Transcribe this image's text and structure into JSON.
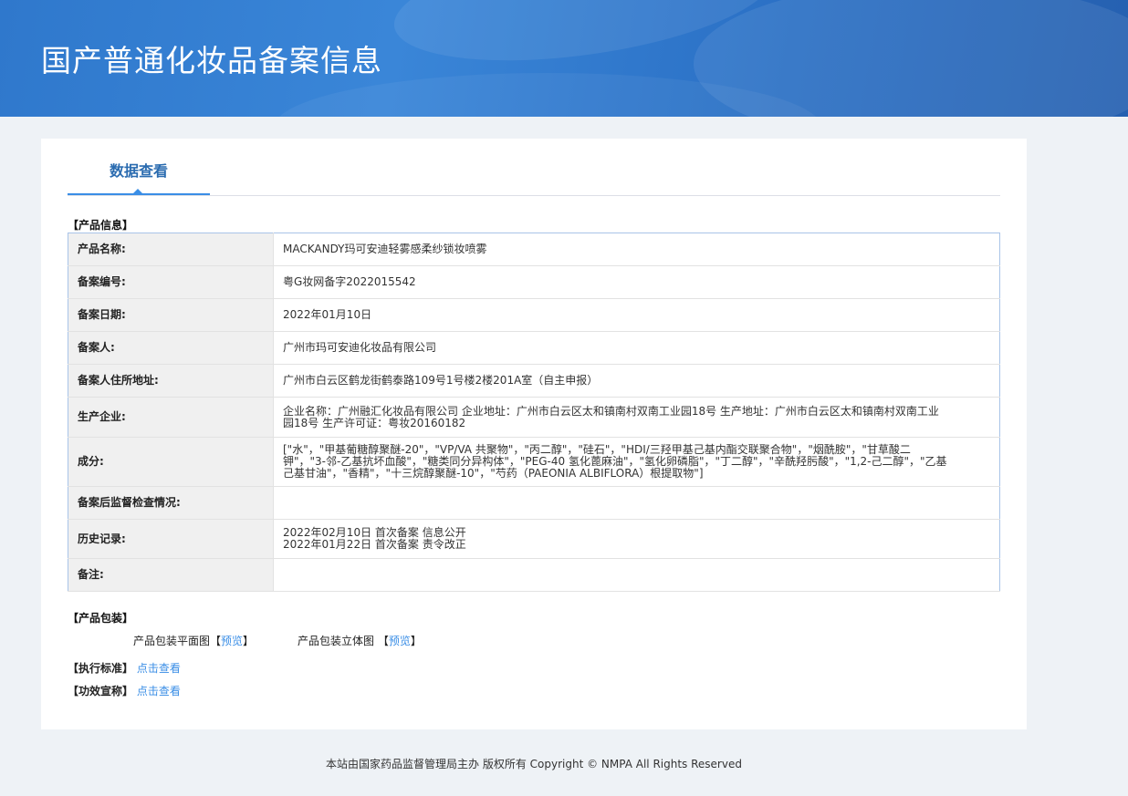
{
  "header": {
    "title": "国产普通化妆品备案信息"
  },
  "tab": {
    "label": "数据查看"
  },
  "product_info": {
    "section_title": "【产品信息】",
    "rows": [
      {
        "label": "产品名称:",
        "value": "MACKANDY玛可安迪轻雾感柔纱锁妆喷雾"
      },
      {
        "label": "备案编号:",
        "value": "粤G妆网备字2022015542"
      },
      {
        "label": "备案日期:",
        "value": "2022年01月10日"
      },
      {
        "label": "备案人:",
        "value": "广州市玛可安迪化妆品有限公司"
      },
      {
        "label": "备案人住所地址:",
        "value": "广州市白云区鹤龙街鹤泰路109号1号楼2楼201A室（自主申报）"
      },
      {
        "label": "生产企业:",
        "value": "企业名称：广州融汇化妆品有限公司 企业地址：广州市白云区太和镇南村双南工业园18号 生产地址：广州市白云区太和镇南村双南工业园18号 生产许可证：粤妆20160182"
      },
      {
        "label": "成分:",
        "value": "[\"水\"，\"甲基葡糖醇聚醚-20\"，\"VP/VA 共聚物\"，\"丙二醇\"，\"硅石\"，\"HDI/三羟甲基己基内酯交联聚合物\"，\"烟酰胺\"，\"甘草酸二钾\"，\"3-邻-乙基抗坏血酸\"，\"糖类同分异构体\"，\"PEG-40 氢化蓖麻油\"，\"氢化卵磷脂\"，\"丁二醇\"，\"辛酰羟肟酸\"，\"1,2-己二醇\"，\"乙基己基甘油\"，\"香精\"，\"十三烷醇聚醚-10\"，\"芍药（PAEONIA ALBIFLORA）根提取物\"]"
      },
      {
        "label": "备案后监督检查情况:",
        "value": ""
      },
      {
        "label": "历史记录:",
        "value": ""
      },
      {
        "label": "备注:",
        "value": ""
      }
    ],
    "history": [
      "2022年02月10日 首次备案 信息公开",
      "2022年01月22日 首次备案 责令改正"
    ]
  },
  "packaging": {
    "section_title": "【产品包装】",
    "flat_label": "产品包装平面图",
    "solid_label": "产品包装立体图 ",
    "lb": "【",
    "rb": "】",
    "preview": "预览"
  },
  "standard": {
    "label": "【执行标准】",
    "link": "点击查看"
  },
  "efficacy": {
    "label": "【功效宣称】",
    "link": "点击查看"
  },
  "footer": {
    "text": "本站由国家药品监督管理局主办 版权所有 Copyright © NMPA All Rights Reserved"
  }
}
